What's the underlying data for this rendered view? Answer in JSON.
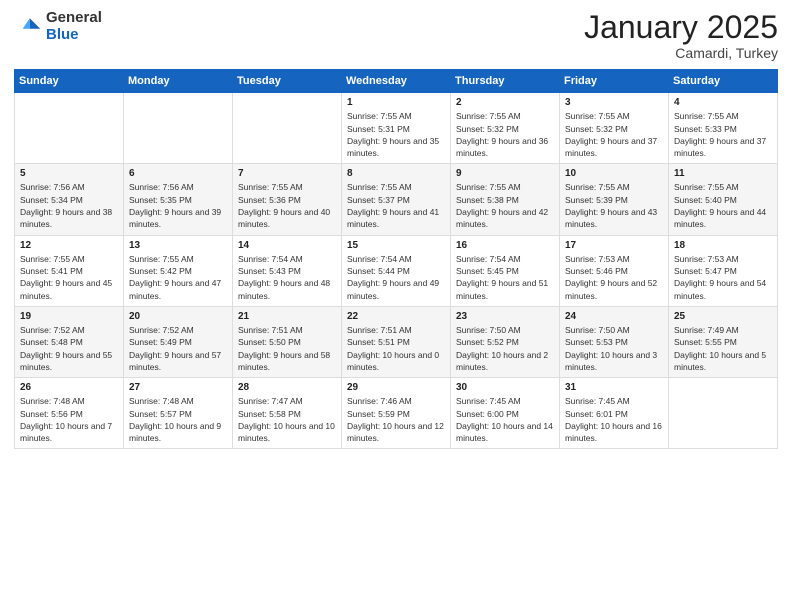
{
  "header": {
    "logo_general": "General",
    "logo_blue": "Blue",
    "title": "January 2025",
    "location": "Camardi, Turkey"
  },
  "columns": [
    "Sunday",
    "Monday",
    "Tuesday",
    "Wednesday",
    "Thursday",
    "Friday",
    "Saturday"
  ],
  "weeks": [
    [
      {
        "day": "",
        "info": ""
      },
      {
        "day": "",
        "info": ""
      },
      {
        "day": "",
        "info": ""
      },
      {
        "day": "1",
        "info": "Sunrise: 7:55 AM\nSunset: 5:31 PM\nDaylight: 9 hours and 35 minutes."
      },
      {
        "day": "2",
        "info": "Sunrise: 7:55 AM\nSunset: 5:32 PM\nDaylight: 9 hours and 36 minutes."
      },
      {
        "day": "3",
        "info": "Sunrise: 7:55 AM\nSunset: 5:32 PM\nDaylight: 9 hours and 37 minutes."
      },
      {
        "day": "4",
        "info": "Sunrise: 7:55 AM\nSunset: 5:33 PM\nDaylight: 9 hours and 37 minutes."
      }
    ],
    [
      {
        "day": "5",
        "info": "Sunrise: 7:56 AM\nSunset: 5:34 PM\nDaylight: 9 hours and 38 minutes."
      },
      {
        "day": "6",
        "info": "Sunrise: 7:56 AM\nSunset: 5:35 PM\nDaylight: 9 hours and 39 minutes."
      },
      {
        "day": "7",
        "info": "Sunrise: 7:55 AM\nSunset: 5:36 PM\nDaylight: 9 hours and 40 minutes."
      },
      {
        "day": "8",
        "info": "Sunrise: 7:55 AM\nSunset: 5:37 PM\nDaylight: 9 hours and 41 minutes."
      },
      {
        "day": "9",
        "info": "Sunrise: 7:55 AM\nSunset: 5:38 PM\nDaylight: 9 hours and 42 minutes."
      },
      {
        "day": "10",
        "info": "Sunrise: 7:55 AM\nSunset: 5:39 PM\nDaylight: 9 hours and 43 minutes."
      },
      {
        "day": "11",
        "info": "Sunrise: 7:55 AM\nSunset: 5:40 PM\nDaylight: 9 hours and 44 minutes."
      }
    ],
    [
      {
        "day": "12",
        "info": "Sunrise: 7:55 AM\nSunset: 5:41 PM\nDaylight: 9 hours and 45 minutes."
      },
      {
        "day": "13",
        "info": "Sunrise: 7:55 AM\nSunset: 5:42 PM\nDaylight: 9 hours and 47 minutes."
      },
      {
        "day": "14",
        "info": "Sunrise: 7:54 AM\nSunset: 5:43 PM\nDaylight: 9 hours and 48 minutes."
      },
      {
        "day": "15",
        "info": "Sunrise: 7:54 AM\nSunset: 5:44 PM\nDaylight: 9 hours and 49 minutes."
      },
      {
        "day": "16",
        "info": "Sunrise: 7:54 AM\nSunset: 5:45 PM\nDaylight: 9 hours and 51 minutes."
      },
      {
        "day": "17",
        "info": "Sunrise: 7:53 AM\nSunset: 5:46 PM\nDaylight: 9 hours and 52 minutes."
      },
      {
        "day": "18",
        "info": "Sunrise: 7:53 AM\nSunset: 5:47 PM\nDaylight: 9 hours and 54 minutes."
      }
    ],
    [
      {
        "day": "19",
        "info": "Sunrise: 7:52 AM\nSunset: 5:48 PM\nDaylight: 9 hours and 55 minutes."
      },
      {
        "day": "20",
        "info": "Sunrise: 7:52 AM\nSunset: 5:49 PM\nDaylight: 9 hours and 57 minutes."
      },
      {
        "day": "21",
        "info": "Sunrise: 7:51 AM\nSunset: 5:50 PM\nDaylight: 9 hours and 58 minutes."
      },
      {
        "day": "22",
        "info": "Sunrise: 7:51 AM\nSunset: 5:51 PM\nDaylight: 10 hours and 0 minutes."
      },
      {
        "day": "23",
        "info": "Sunrise: 7:50 AM\nSunset: 5:52 PM\nDaylight: 10 hours and 2 minutes."
      },
      {
        "day": "24",
        "info": "Sunrise: 7:50 AM\nSunset: 5:53 PM\nDaylight: 10 hours and 3 minutes."
      },
      {
        "day": "25",
        "info": "Sunrise: 7:49 AM\nSunset: 5:55 PM\nDaylight: 10 hours and 5 minutes."
      }
    ],
    [
      {
        "day": "26",
        "info": "Sunrise: 7:48 AM\nSunset: 5:56 PM\nDaylight: 10 hours and 7 minutes."
      },
      {
        "day": "27",
        "info": "Sunrise: 7:48 AM\nSunset: 5:57 PM\nDaylight: 10 hours and 9 minutes."
      },
      {
        "day": "28",
        "info": "Sunrise: 7:47 AM\nSunset: 5:58 PM\nDaylight: 10 hours and 10 minutes."
      },
      {
        "day": "29",
        "info": "Sunrise: 7:46 AM\nSunset: 5:59 PM\nDaylight: 10 hours and 12 minutes."
      },
      {
        "day": "30",
        "info": "Sunrise: 7:45 AM\nSunset: 6:00 PM\nDaylight: 10 hours and 14 minutes."
      },
      {
        "day": "31",
        "info": "Sunrise: 7:45 AM\nSunset: 6:01 PM\nDaylight: 10 hours and 16 minutes."
      },
      {
        "day": "",
        "info": ""
      }
    ]
  ]
}
